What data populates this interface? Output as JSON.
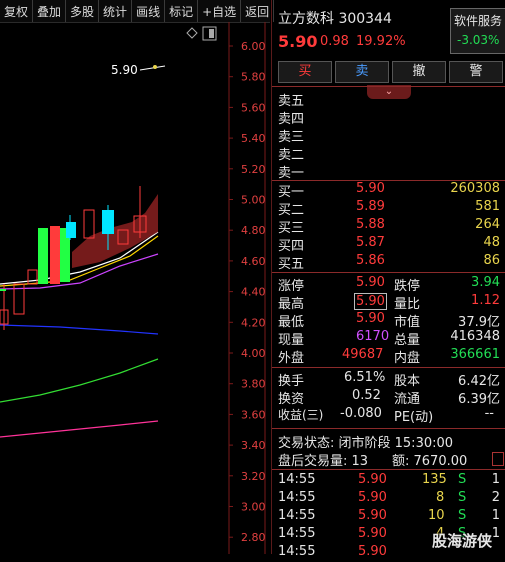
{
  "toolbar": {
    "items": [
      "复权",
      "叠加",
      "多股",
      "统计",
      "画线",
      "标记",
      "+自选",
      "返回"
    ]
  },
  "chart": {
    "y_labels": [
      "6.00",
      "5.80",
      "5.60",
      "5.40",
      "5.20",
      "5.00",
      "4.80",
      "4.60",
      "4.40",
      "4.20",
      "4.00",
      "3.80",
      "3.60",
      "3.40",
      "3.20",
      "3.00",
      "2.80"
    ],
    "annotation": "5.90",
    "colors": {
      "up": "#ff3b3b",
      "down": "#00e6ff",
      "limit_up": "#22ff44",
      "ma1": "#ffffff",
      "ma2": "#ffd700",
      "ma3": "#cc44ff",
      "ma4": "#2233ff",
      "ma5": "#33dd33",
      "ma6": "#ff3399"
    }
  },
  "header": {
    "title": "立方数科 300344",
    "price": "5.90",
    "change": "0.98",
    "change_pct": "19.92%",
    "sector_label": "软件服务",
    "sector_change": "-3.03%"
  },
  "actions": {
    "buy": "买",
    "sell": "卖",
    "cancel": "撤",
    "alert": "警"
  },
  "sell_levels": [
    {
      "label": "卖五",
      "price": "",
      "vol": ""
    },
    {
      "label": "卖四",
      "price": "",
      "vol": ""
    },
    {
      "label": "卖三",
      "price": "",
      "vol": ""
    },
    {
      "label": "卖二",
      "price": "",
      "vol": ""
    },
    {
      "label": "卖一",
      "price": "",
      "vol": ""
    }
  ],
  "buy_levels": [
    {
      "label": "买一",
      "price": "5.90",
      "vol": "260308"
    },
    {
      "label": "买二",
      "price": "5.89",
      "vol": "581"
    },
    {
      "label": "买三",
      "price": "5.88",
      "vol": "264"
    },
    {
      "label": "买四",
      "price": "5.87",
      "vol": "48"
    },
    {
      "label": "买五",
      "price": "5.86",
      "vol": "86"
    }
  ],
  "stats": {
    "r1": {
      "l1": "涨停",
      "v1": "5.90",
      "l2": "跌停",
      "v2": "3.94"
    },
    "r2": {
      "l1": "最高",
      "v1": "5.90",
      "l2": "量比",
      "v2": "1.12"
    },
    "r3": {
      "l1": "最低",
      "v1": "5.90",
      "l2": "市值",
      "v2": "37.9亿"
    },
    "r4": {
      "l1": "现量",
      "v1": "6170",
      "l2": "总量",
      "v2": "416348"
    },
    "r5": {
      "l1": "外盘",
      "v1": "49687",
      "l2": "内盘",
      "v2": "366661"
    },
    "r6": {
      "l1": "换手",
      "v1": "6.51%",
      "l2": "股本",
      "v2": "6.42亿"
    },
    "r7": {
      "l1": "换资",
      "v1": "0.52",
      "l2": "流通",
      "v2": "6.39亿"
    },
    "r8": {
      "l1": "收益(三)",
      "v1": "-0.080",
      "l2": "PE(动)",
      "v2": "--"
    }
  },
  "trade_status": {
    "line1": "交易状态: 闭市阶段 15:30:00",
    "line2_label": "盘后交易量: 13",
    "line2_amount": "额: 7670.00"
  },
  "ticks": [
    {
      "time": "14:55",
      "price": "5.90",
      "vol": "135",
      "side": "S",
      "n": "1"
    },
    {
      "time": "14:55",
      "price": "5.90",
      "vol": "8",
      "side": "S",
      "n": "2"
    },
    {
      "time": "14:55",
      "price": "5.90",
      "vol": "10",
      "side": "S",
      "n": "1"
    },
    {
      "time": "14:55",
      "price": "5.90",
      "vol": "4",
      "side": "S",
      "n": "1"
    },
    {
      "time": "14:55",
      "price": "5.90",
      "vol": "",
      "side": "",
      "n": ""
    }
  ],
  "watermark": "股海游侠"
}
